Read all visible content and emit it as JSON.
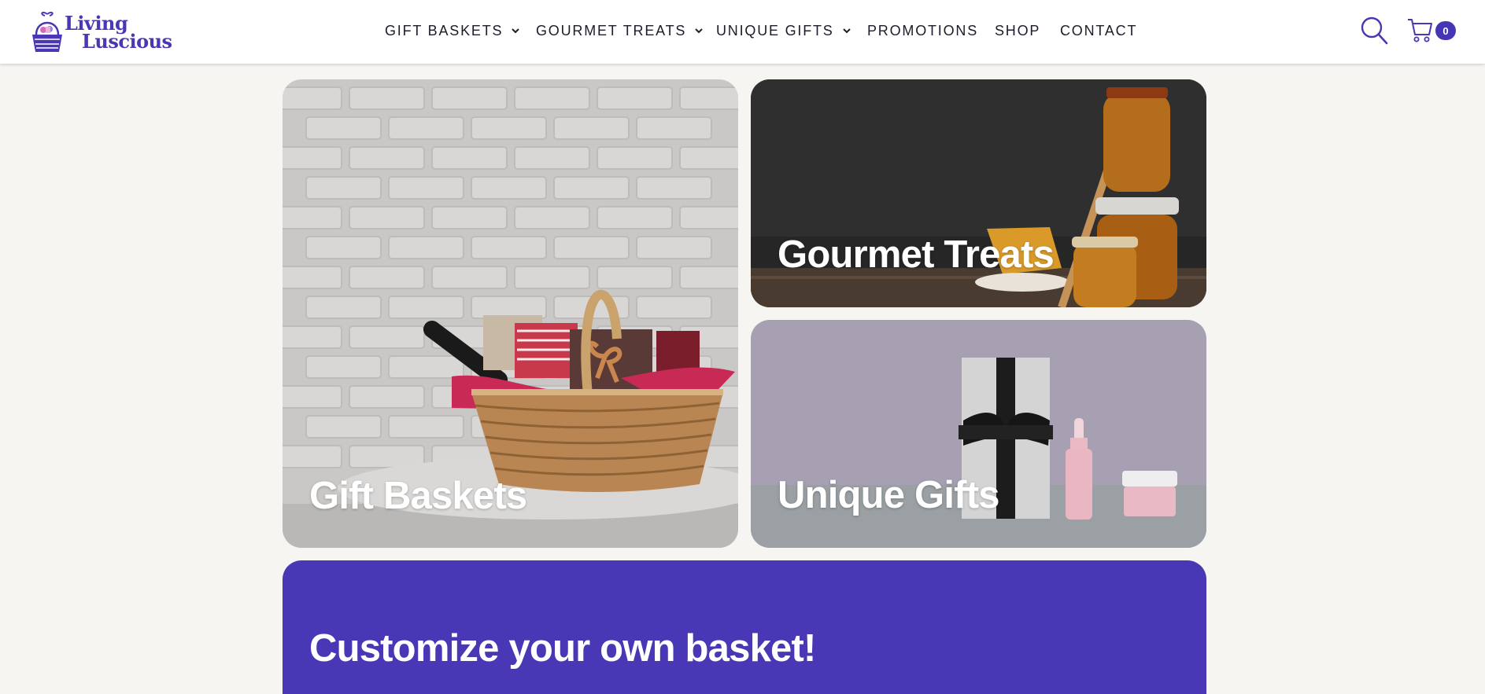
{
  "brand": {
    "line1": "Living",
    "line2": "Luscious",
    "color": "#4b37b3"
  },
  "nav": {
    "items": [
      {
        "label": "GIFT BASKETS",
        "has_dropdown": true
      },
      {
        "label": "GOURMET TREATS",
        "has_dropdown": true
      },
      {
        "label": "UNIQUE GIFTS",
        "has_dropdown": true
      },
      {
        "label": "PROMOTIONS",
        "has_dropdown": false
      },
      {
        "label": "SHOP",
        "has_dropdown": false
      },
      {
        "label": "CONTACT",
        "has_dropdown": false
      }
    ]
  },
  "header_actions": {
    "search_icon": "search-icon",
    "cart_icon": "cart-icon",
    "cart_count": "0"
  },
  "tiles": {
    "gift_baskets": {
      "title": "Gift Baskets"
    },
    "gourmet_treats": {
      "title": "Gourmet Treats"
    },
    "unique_gifts": {
      "title": "Unique Gifts"
    }
  },
  "banner": {
    "title": "Customize your own basket!",
    "color": "#4838b5"
  },
  "colors": {
    "accent": "#4536b3",
    "background": "#f6f5f2",
    "nav_text": "#1c1c2a"
  }
}
